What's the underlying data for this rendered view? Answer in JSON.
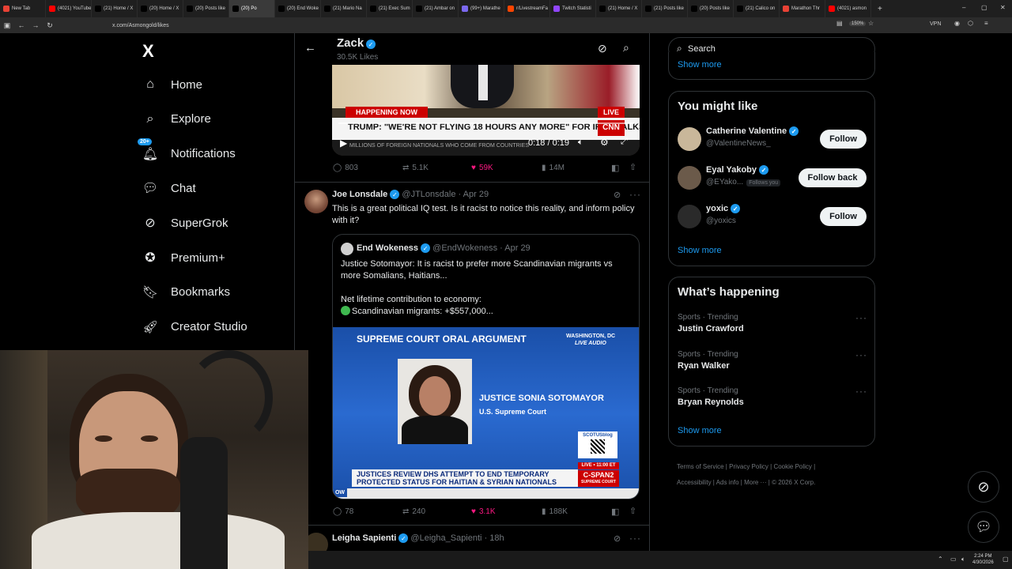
{
  "browser": {
    "tabs": [
      {
        "label": "New Tab",
        "color": "#e94235"
      },
      {
        "label": "(4021) YouTube",
        "color": "#ff0000"
      },
      {
        "label": "(21) Home / X",
        "color": "#000000"
      },
      {
        "label": "(20) Home / X",
        "color": "#000000"
      },
      {
        "label": "(20) Posts like",
        "color": "#000000"
      },
      {
        "label": "(20) Po",
        "color": "#000000",
        "active": true
      },
      {
        "label": "(20) End Woke",
        "color": "#000000"
      },
      {
        "label": "(21) Mario Na",
        "color": "#000000"
      },
      {
        "label": "(21) Exec Sum",
        "color": "#000000"
      },
      {
        "label": "(21) Ambar on",
        "color": "#000000"
      },
      {
        "label": "(99+) Marathe",
        "color": "#7b68ee"
      },
      {
        "label": "r/LivestreamFa",
        "color": "#ff4500"
      },
      {
        "label": "Twitch Statisti",
        "color": "#9146ff"
      },
      {
        "label": "(21) Home / X",
        "color": "#000000"
      },
      {
        "label": "(21) Posts like",
        "color": "#000000"
      },
      {
        "label": "(20) Posts like",
        "color": "#000000"
      },
      {
        "label": "(21) Calico on",
        "color": "#000000"
      },
      {
        "label": "Marathon Thr",
        "color": "#e94235"
      },
      {
        "label": "(4021) asmon",
        "color": "#ff0000"
      }
    ],
    "new_tab": "+",
    "url": "x.com/Asmongold/likes",
    "zoom": "150%",
    "vpn": "VPN",
    "clock_time": "2:24 PM",
    "clock_date": "4/30/2026"
  },
  "nav": {
    "logo": "X",
    "items": [
      {
        "label": "Home",
        "icon": "home-icon"
      },
      {
        "label": "Explore",
        "icon": "search-icon"
      },
      {
        "label": "Notifications",
        "icon": "bell-icon",
        "badge": "20+"
      },
      {
        "label": "Chat",
        "icon": "chat-icon"
      },
      {
        "label": "SuperGrok",
        "icon": "grok-icon"
      },
      {
        "label": "Premium+",
        "icon": "verified-icon"
      },
      {
        "label": "Bookmarks",
        "icon": "bookmark-icon"
      },
      {
        "label": "Creator Studio",
        "icon": "rocket-icon"
      }
    ]
  },
  "header": {
    "name": "Zack",
    "likes": "30.5K Likes"
  },
  "video1": {
    "banner": "HAPPENING NOW",
    "live": "LIVE",
    "headline": "TRUMP: \"WE'RE NOT FLYING 18 HOURS ANY MORE\" FOR IRAN TALKS",
    "subline": "MILLIONS OF FOREIGN NATIONALS WHO COME FROM COUNTRIES",
    "network": "CNN",
    "time": "0:18 / 0:19",
    "replies": "803",
    "reposts": "5.1K",
    "likes": "59K",
    "views": "14M"
  },
  "tweet2": {
    "name": "Joe Lonsdale",
    "handle": "@JTLonsdale",
    "date": "Apr 29",
    "text": "This is a great political IQ test. Is it racist to notice this reality, and inform policy with it?",
    "quote": {
      "name": "End Wokeness",
      "handle": "@EndWokeness",
      "date": "Apr 29",
      "line1": "Justice Sotomayor: It is racist to prefer more Scandinavian migrants vs more Somalians, Haitians...",
      "line2": "Net lifetime contribution to economy:",
      "line3": "Scandinavian migrants: +$557,000..."
    },
    "image": {
      "title": "SUPREME COURT ORAL ARGUMENT",
      "location": "WASHINGTON, DC",
      "audio": "LIVE AUDIO",
      "justice": "JUSTICE SONIA SOTOMAYOR",
      "court": "U.S. Supreme Court",
      "blog": "SCOTUSblog",
      "live_time": "LIVE • 11:00 ET",
      "network": "C-SPAN2",
      "network_sub": "SUPREME COURT",
      "ticker1": "JUSTICES REVIEW DHS ATTEMPT TO END TEMPORARY",
      "ticker2": "PROTECTED STATUS FOR HAITIAN & SYRIAN NATIONALS",
      "corner": "OW"
    },
    "replies": "78",
    "reposts": "240",
    "likes": "3.1K",
    "views": "188K"
  },
  "tweet3": {
    "name": "Leigha Sapienti",
    "handle": "@Leigha_Sapienti",
    "date": "18h"
  },
  "search": {
    "placeholder": "Search"
  },
  "show_more_top": "Show more",
  "suggestions": {
    "title": "You might like",
    "items": [
      {
        "name": "Catherine Valentine",
        "handle": "@ValentineNews_",
        "button": "Follow"
      },
      {
        "name": "Eyal Yakoby",
        "handle": "@EYako...",
        "follows_you": "Follows you",
        "button": "Follow back"
      },
      {
        "name": "yoxic",
        "handle": "@yoxics",
        "button": "Follow"
      }
    ],
    "show_more": "Show more"
  },
  "trends": {
    "title": "What’s happening",
    "items": [
      {
        "category": "Sports · Trending",
        "name": "Justin Crawford"
      },
      {
        "category": "Sports · Trending",
        "name": "Ryan Walker"
      },
      {
        "category": "Sports · Trending",
        "name": "Bryan Reynolds"
      }
    ],
    "show_more": "Show more"
  },
  "footer": {
    "links": [
      "Terms of Service",
      "Privacy Policy",
      "Cookie Policy",
      "Accessibility",
      "Ads info",
      "More ···",
      "© 2026 X Corp."
    ]
  },
  "colors": {
    "accent": "#1d9bf0",
    "like": "#f91880",
    "live_red": "#cc0000"
  }
}
